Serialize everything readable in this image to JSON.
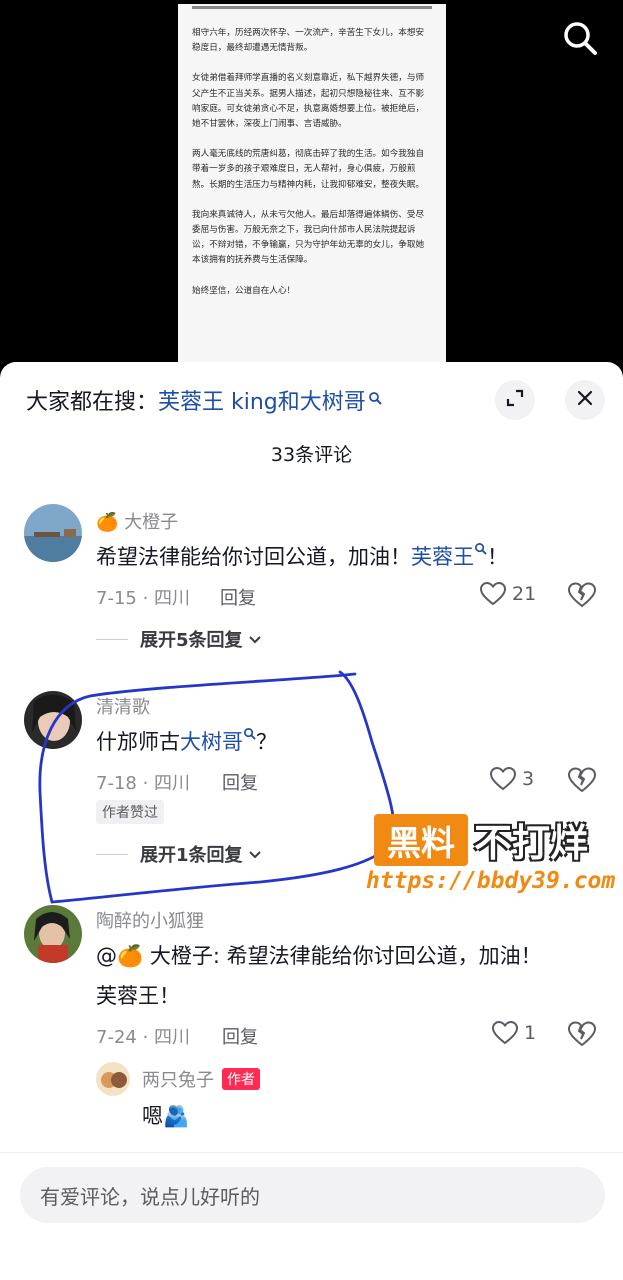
{
  "video": {
    "paragraphs": [
      "相守六年，历经两次怀孕、一次流产，辛苦生下女儿，本想安稳度日，最终却遭遇无情背叛。",
      "女徒弟借着拜师学直播的名义刻意靠近，私下越界失德，与师父产生不正当关系。据男人描述，起初只想隐秘往来、互不影响家庭。可女徒弟贪心不足，执意离婚想要上位。被拒绝后，她不甘罢休，深夜上门闹事、言语威胁。",
      "两人毫无底线的荒唐纠葛，彻底击碎了我的生活。如今我独自带着一岁多的孩子艰难度日，无人帮衬，身心俱疲，万般煎熬。长期的生活压力与精神内耗，让我抑郁难安，整夜失眠。",
      "我向来真诚待人，从未亏欠他人。最后却落得遍体鳞伤、受尽委屈与伤害。万般无奈之下，我已向什邡市人民法院提起诉讼，不辩对错，不争输赢，只为守护年幼无辜的女儿，争取她本该拥有的抚养费与生活保障。",
      "始终坚信，公道自在人心！"
    ],
    "search_icon": "search-icon"
  },
  "header": {
    "search_prefix": "大家都在搜：",
    "search_keyword": "芙蓉王 king和大树哥",
    "expand_icon": "expand-icon",
    "close_icon": "close-icon"
  },
  "comment_count": "33条评论",
  "comments": [
    {
      "username": "🍊 大橙子",
      "text_plain": "希望法律能给你讨回公道，加油！",
      "text_link": "芙蓉王",
      "text_after": "！",
      "date_loc": "7-15 · 四川",
      "reply_label": "回复",
      "likes": "21",
      "expand_label": "展开5条回复"
    },
    {
      "username": "清清歌",
      "text_plain": "什邡师古",
      "text_link": "大树哥",
      "text_after": "？",
      "date_loc": "7-18 · 四川",
      "reply_label": "回复",
      "likes": "3",
      "badge": "作者赞过",
      "expand_label": "展开1条回复"
    },
    {
      "username": "陶醉的小狐狸",
      "line1": "@🍊 大橙子: 希望法律能给你讨回公道，加油！",
      "line2": "芙蓉王！",
      "date_loc": "7-24 · 四川",
      "reply_label": "回复",
      "likes": "1"
    }
  ],
  "sub_reply": {
    "username": "两只兔子",
    "author_tag": "作者",
    "text": "嗯🫂"
  },
  "input_placeholder": "有爱评论，说点儿好听的",
  "watermark": {
    "box_text": "黑料",
    "text": "不打烊",
    "url": "https://bbdy39.com"
  },
  "colors": {
    "link": "#1e4ea8",
    "annotation": "#2636c8",
    "author_tag": "#fe2c55",
    "watermark": "#f08a12"
  }
}
